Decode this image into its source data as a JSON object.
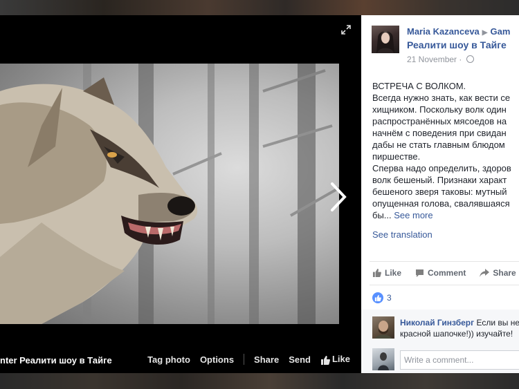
{
  "lightbox": {
    "caption": "nter Реалити шоу в Тайге",
    "actions": {
      "tag_photo": "Tag photo",
      "options": "Options",
      "share": "Share",
      "send": "Send",
      "like": "Like"
    }
  },
  "post": {
    "author": "Maria Kazanceva",
    "group_prefix": "Gam",
    "group_name": "Реалити шоу в Тайге",
    "date": "21 November",
    "body_lines": [
      "ВСТРЕЧА С ВОЛКОМ.",
      "Всегда нужно знать, как вести се",
      "хищником. Поскольку волк один",
      "распространённых мясоедов на",
      "начнём с поведения при свидан",
      "дабы не стать главным блюдом",
      "пиршестве.",
      "Сперва надо определить, здоров",
      "волк бешеный. Признаки характ",
      "бешеного зверя таковы: мутный",
      "опущенная голова, свалявшаяся"
    ],
    "truncated_tail": "бы...",
    "see_more": "See more",
    "see_translation": "See translation",
    "actions": {
      "like": "Like",
      "comment": "Comment",
      "share": "Share"
    },
    "reaction_count": "3"
  },
  "comments": {
    "first": {
      "name": "Николай Гинзберг",
      "text_line1": "Если вы не",
      "text_line2": "красной шапочке!)) изучайте!"
    },
    "input_placeholder": "Write a comment..."
  },
  "colors": {
    "link": "#365899",
    "muted": "#90949c",
    "like_blue": "#5890ff"
  },
  "icons": [
    "expand-icon",
    "chevron-right-icon",
    "thumbs-up-icon",
    "comment-icon",
    "share-icon",
    "globe-icon",
    "like-reaction-icon"
  ]
}
